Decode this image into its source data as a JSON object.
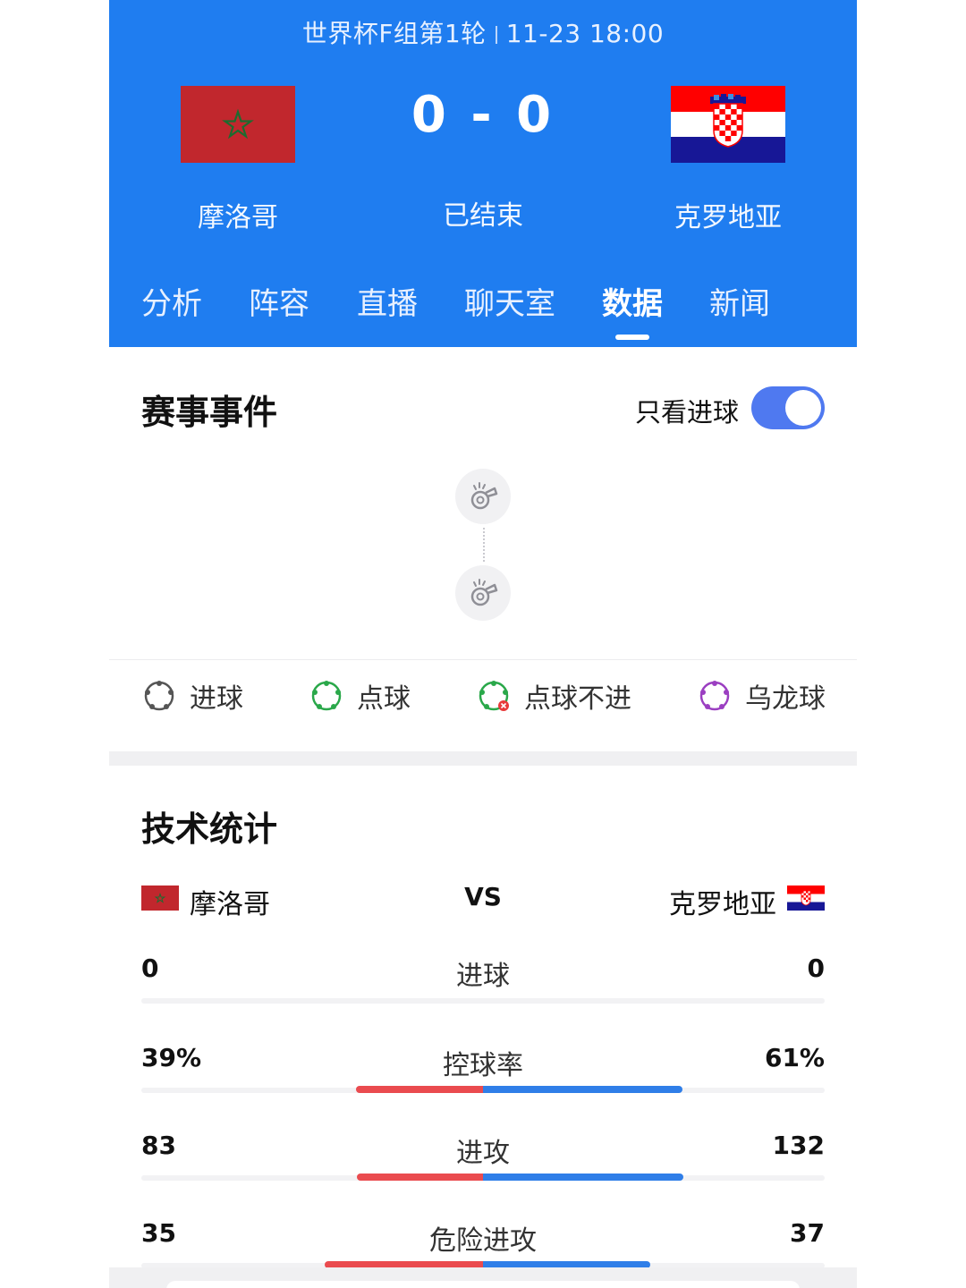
{
  "header": {
    "competition": "世界杯F组第1轮",
    "datetime": "11-23 18:00",
    "score": "0 - 0",
    "status": "已结束",
    "home_team": "摩洛哥",
    "away_team": "克罗地亚",
    "home_flag": "morocco-flag",
    "away_flag": "croatia-flag"
  },
  "tabs": [
    {
      "label": "分析"
    },
    {
      "label": "阵容"
    },
    {
      "label": "直播"
    },
    {
      "label": "聊天室"
    },
    {
      "label": "数据",
      "active": true
    },
    {
      "label": "新闻"
    }
  ],
  "events": {
    "title": "赛事事件",
    "goal_only_label": "只看进球",
    "goal_only_on": true,
    "timeline_icons": [
      "whistle-icon",
      "whistle-icon"
    ]
  },
  "legend": [
    {
      "label": "进球",
      "icon": "goal-icon",
      "color": "#555555"
    },
    {
      "label": "点球",
      "icon": "penalty-icon",
      "color": "#2aa84a"
    },
    {
      "label": "点球不进",
      "icon": "penalty-missed-icon",
      "color": "#2aa84a"
    },
    {
      "label": "乌龙球",
      "icon": "own-goal-icon",
      "color": "#9b3fc1"
    }
  ],
  "stats": {
    "title": "技术统计",
    "home_team": "摩洛哥",
    "away_team": "克罗地亚",
    "vs": "VS",
    "rows": [
      {
        "label": "进球",
        "home": "0",
        "away": "0",
        "home_value": 0,
        "away_value": 0
      },
      {
        "label": "控球率",
        "home": "39%",
        "away": "61%",
        "home_value": 39,
        "away_value": 61
      },
      {
        "label": "进攻",
        "home": "83",
        "away": "132",
        "home_value": 83,
        "away_value": 132
      },
      {
        "label": "危险进攻",
        "home": "35",
        "away": "37",
        "home_value": 35,
        "away_value": 37
      }
    ]
  },
  "colors": {
    "header_bg": "#1f7df0",
    "home_bar": "#ea4b4f",
    "away_bar": "#2f7ee8",
    "toggle_on": "#4f79f0"
  }
}
